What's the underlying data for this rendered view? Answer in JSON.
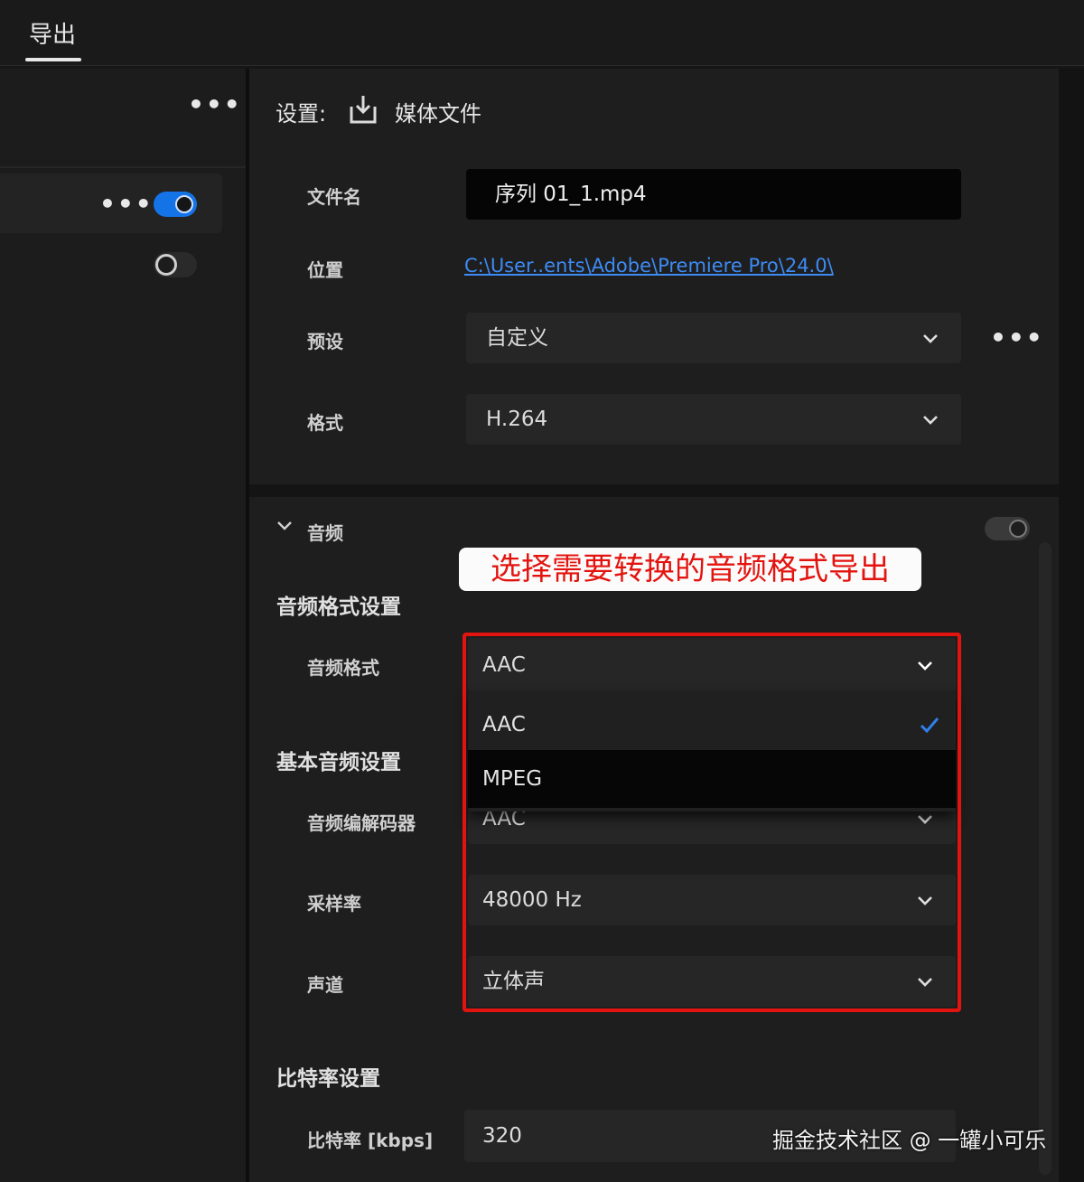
{
  "top_tab": {
    "label": "导出"
  },
  "left_panel": {
    "rows": [
      {
        "more": "•••",
        "enabled": true
      },
      {
        "enabled": false
      }
    ],
    "header_more": "•••"
  },
  "settings": {
    "title": "设置:",
    "destination_label": "媒体文件",
    "filename": {
      "label": "文件名",
      "value": "序列 01_1.mp4"
    },
    "location": {
      "label": "位置",
      "value": "C:\\User..ents\\Adobe\\Premiere Pro\\24.0\\"
    },
    "preset": {
      "label": "预设",
      "value": "自定义",
      "more": "•••"
    },
    "format": {
      "label": "格式",
      "value": "H.264"
    }
  },
  "audio": {
    "section_label": "音频",
    "enabled": true,
    "format_settings_heading": "音频格式设置",
    "audio_format": {
      "label": "音频格式",
      "value": "AAC"
    },
    "dropdown_options": [
      {
        "label": "AAC",
        "selected": true
      },
      {
        "label": "MPEG",
        "selected": false
      }
    ],
    "basic_heading": "基本音频设置",
    "codec": {
      "label": "音频编解码器",
      "value": "AAC"
    },
    "sample_rate": {
      "label": "采样率",
      "value": "48000 Hz"
    },
    "channels": {
      "label": "声道",
      "value": "立体声"
    },
    "bitrate_heading": "比特率设置",
    "bitrate": {
      "label": "比特率 [kbps]",
      "value": "320"
    }
  },
  "annotation": {
    "text": "选择需要转换的音频格式导出",
    "color": "#e3140f"
  },
  "watermark": {
    "text": "掘金技术社区 @ 一罐小可乐"
  },
  "colors": {
    "accent": "#1473e6",
    "link": "#3d8bf5",
    "highlight_box": "#e3140f"
  }
}
